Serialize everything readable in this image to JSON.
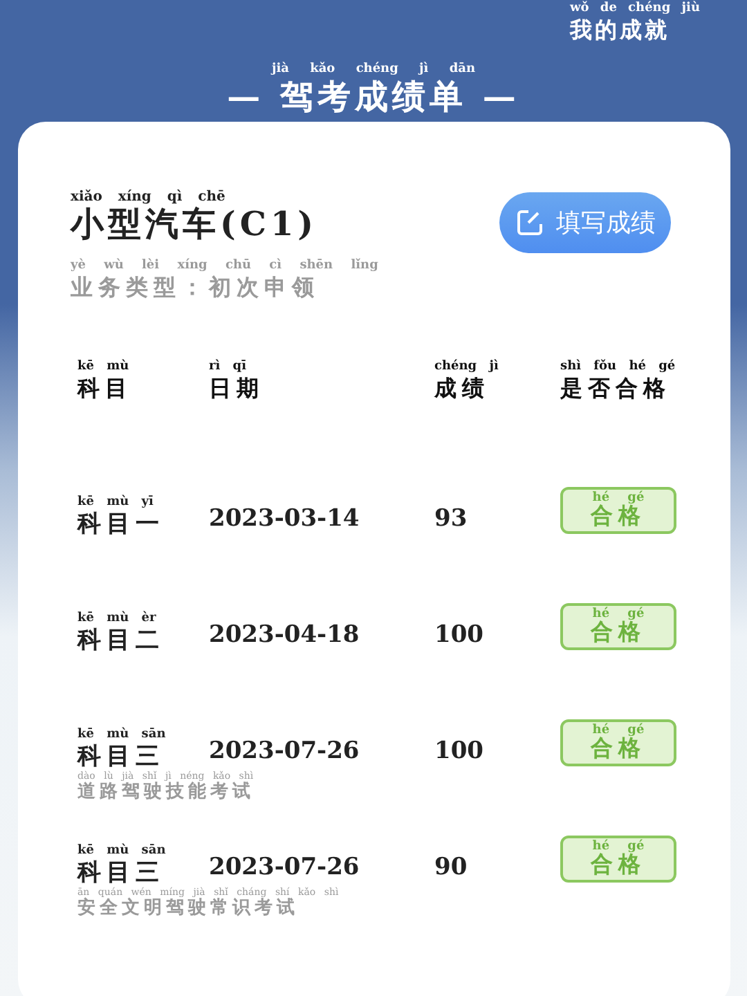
{
  "header": {
    "link": {
      "text": "我的成就",
      "pinyin": "wǒ de chéng jiù"
    },
    "title": {
      "text": "— 驾考成绩单 —",
      "pinyin": "jià kǎo chéng jì dān"
    }
  },
  "card": {
    "vehicle": {
      "text": "小型汽车(C1)",
      "pinyin": "xiǎo xíng qì chē"
    },
    "business_type": {
      "text": "业务类型：初次申领",
      "pinyin": "yè wù lèi xíng chū cì shēn lǐng"
    },
    "fill_button": {
      "label": "填写成绩"
    }
  },
  "table": {
    "columns": [
      {
        "text": "科目",
        "pinyin": "kē mù"
      },
      {
        "text": "日期",
        "pinyin": "rì qī"
      },
      {
        "text": "成绩",
        "pinyin": "chéng jì"
      },
      {
        "text": "是否合格",
        "pinyin": "shì fǒu hé gé"
      }
    ],
    "rows": [
      {
        "subject": {
          "text": "科目一",
          "pinyin": "kē mù yī"
        },
        "date": "2023-03-14",
        "score": "93",
        "result": {
          "text": "合格",
          "pinyin": "hé gé"
        }
      },
      {
        "subject": {
          "text": "科目二",
          "pinyin": "kē mù èr"
        },
        "date": "2023-04-18",
        "score": "100",
        "result": {
          "text": "合格",
          "pinyin": "hé gé"
        }
      },
      {
        "subject": {
          "text": "科目三",
          "pinyin": "kē mù sān"
        },
        "date": "2023-07-26",
        "score": "100",
        "result": {
          "text": "合格",
          "pinyin": "hé gé"
        },
        "note": {
          "text": "道路驾驶技能考试",
          "pinyin": "dào lù jià shǐ jì néng kǎo shì"
        }
      },
      {
        "subject": {
          "text": "科目三",
          "pinyin": "kē mù sān"
        },
        "date": "2023-07-26",
        "score": "90",
        "result": {
          "text": "合格",
          "pinyin": "hé gé"
        },
        "note": {
          "text": "安全文明驾驶常识考试",
          "pinyin": "ān quán wén míng jià shǐ cháng shí kǎo shì"
        }
      }
    ]
  }
}
